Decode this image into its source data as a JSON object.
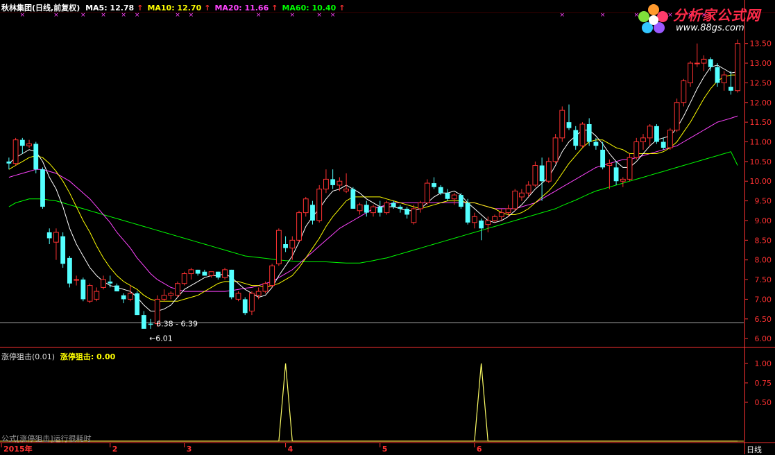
{
  "header": {
    "stock": "秋林集团(日线,前复权)",
    "ma": [
      {
        "label": "MA5: 12.78",
        "color": "#ffffff"
      },
      {
        "label": "MA10: 12.70",
        "color": "#ffff00"
      },
      {
        "label": "MA20: 11.66",
        "color": "#ff44ff"
      },
      {
        "label": "MA60: 10.40",
        "color": "#00ff00"
      }
    ],
    "arrow": "↑"
  },
  "sub_header": {
    "name": "涨停狙击(0.01)",
    "value_label": "涨停狙击: 0.00"
  },
  "logo": {
    "name": "分析家公式网",
    "url": "www.88gs.com"
  },
  "footer": {
    "formula": "公式[涨停狙击]运行很耗时",
    "period": "日线"
  },
  "colors": {
    "up": "#ff3232",
    "down": "#54ffff",
    "ma5": "#ffffff",
    "ma10": "#ffff00",
    "ma20": "#ff44ff",
    "ma60": "#00ff00",
    "grid": "#a00000",
    "axis": "#ff3232",
    "signal": "#ffff66"
  },
  "chart_data": {
    "type": "candlestick",
    "price_ticks": [
      "13.50",
      "13.00",
      "12.50",
      "12.00",
      "11.50",
      "11.00",
      "10.50",
      "10.00",
      "9.50",
      "9.00",
      "8.50",
      "8.00",
      "7.50",
      "7.00",
      "6.50",
      "6.00"
    ],
    "price_ylim": [
      5.95,
      13.6
    ],
    "reference_line": 6.4,
    "low_annotation": {
      "range_label": "6.38 - 6.39",
      "low_label": "←6.01"
    },
    "date_labels": [
      "2015年",
      "2",
      "3",
      "4",
      "5",
      "6"
    ],
    "date_label_index": [
      0,
      15,
      26,
      41,
      55,
      69
    ],
    "candles": [
      [
        10.5,
        10.6,
        10.3,
        10.45
      ],
      [
        10.45,
        11.1,
        10.4,
        11.05
      ],
      [
        11.05,
        11.1,
        10.7,
        10.9
      ],
      [
        10.9,
        11.05,
        10.85,
        10.95
      ],
      [
        10.95,
        11.0,
        10.2,
        10.3
      ],
      [
        10.3,
        10.35,
        9.3,
        9.35
      ],
      [
        8.7,
        8.8,
        8.4,
        8.55
      ],
      [
        8.45,
        8.8,
        8.0,
        8.7
      ],
      [
        8.6,
        8.7,
        7.8,
        7.9
      ],
      [
        8.05,
        8.1,
        7.3,
        7.4
      ],
      [
        7.5,
        7.6,
        7.35,
        7.5
      ],
      [
        7.5,
        7.55,
        6.95,
        7.0
      ],
      [
        6.95,
        7.4,
        6.9,
        7.35
      ],
      [
        7.0,
        7.3,
        6.95,
        7.2
      ],
      [
        7.3,
        7.6,
        7.25,
        7.5
      ],
      [
        7.45,
        7.6,
        7.3,
        7.4
      ],
      [
        7.35,
        7.4,
        7.2,
        7.2
      ],
      [
        7.1,
        7.15,
        6.9,
        7.0
      ],
      [
        7.0,
        7.35,
        6.95,
        7.15
      ],
      [
        7.15,
        7.2,
        6.6,
        6.6
      ],
      [
        6.6,
        6.7,
        6.25,
        6.25
      ],
      [
        6.38,
        6.5,
        6.25,
        6.35
      ],
      [
        6.38,
        7.1,
        6.3,
        7.0
      ],
      [
        7.0,
        7.25,
        6.95,
        7.1
      ],
      [
        7.1,
        7.2,
        7.0,
        7.15
      ],
      [
        7.1,
        7.45,
        7.05,
        7.4
      ],
      [
        7.4,
        7.7,
        7.35,
        7.65
      ],
      [
        7.65,
        7.8,
        7.5,
        7.75
      ],
      [
        7.75,
        7.75,
        7.6,
        7.65
      ],
      [
        7.7,
        7.75,
        7.6,
        7.6
      ],
      [
        7.6,
        7.7,
        7.55,
        7.7
      ],
      [
        7.7,
        7.7,
        7.5,
        7.55
      ],
      [
        7.55,
        7.8,
        7.5,
        7.75
      ],
      [
        7.75,
        7.75,
        7.0,
        7.05
      ],
      [
        7.0,
        7.2,
        6.95,
        7.15
      ],
      [
        7.0,
        7.05,
        6.6,
        6.65
      ],
      [
        6.7,
        7.2,
        6.6,
        7.15
      ],
      [
        7.1,
        7.3,
        7.0,
        7.2
      ],
      [
        7.2,
        7.45,
        7.15,
        7.4
      ],
      [
        7.35,
        7.9,
        7.3,
        7.85
      ],
      [
        7.9,
        8.8,
        7.85,
        8.75
      ],
      [
        8.4,
        8.6,
        8.2,
        8.3
      ],
      [
        8.3,
        8.6,
        8.0,
        8.5
      ],
      [
        8.5,
        9.25,
        8.45,
        9.2
      ],
      [
        9.2,
        9.6,
        9.1,
        9.55
      ],
      [
        9.4,
        9.5,
        8.9,
        9.0
      ],
      [
        9.0,
        9.9,
        8.95,
        9.8
      ],
      [
        9.8,
        10.3,
        9.7,
        10.05
      ],
      [
        10.05,
        10.3,
        9.8,
        9.9
      ],
      [
        9.9,
        10.1,
        9.75,
        10.0
      ],
      [
        9.75,
        10.2,
        9.7,
        9.8
      ],
      [
        9.8,
        9.85,
        9.3,
        9.3
      ],
      [
        9.25,
        9.45,
        9.15,
        9.4
      ],
      [
        9.4,
        9.5,
        9.1,
        9.2
      ],
      [
        9.2,
        9.4,
        9.1,
        9.35
      ],
      [
        9.35,
        9.5,
        9.1,
        9.2
      ],
      [
        9.2,
        9.5,
        9.15,
        9.45
      ],
      [
        9.45,
        9.5,
        9.3,
        9.35
      ],
      [
        9.35,
        9.4,
        9.2,
        9.3
      ],
      [
        9.3,
        9.35,
        9.05,
        9.15
      ],
      [
        8.95,
        9.4,
        8.9,
        9.3
      ],
      [
        9.3,
        9.5,
        9.2,
        9.45
      ],
      [
        9.45,
        10.05,
        9.4,
        9.95
      ],
      [
        9.95,
        10.1,
        9.8,
        9.85
      ],
      [
        9.85,
        9.9,
        9.65,
        9.7
      ],
      [
        9.7,
        9.8,
        9.5,
        9.55
      ],
      [
        9.55,
        9.7,
        9.4,
        9.65
      ],
      [
        9.65,
        9.7,
        9.3,
        9.35
      ],
      [
        9.45,
        9.55,
        8.9,
        8.95
      ],
      [
        8.95,
        9.2,
        8.8,
        9.1
      ],
      [
        9.0,
        9.05,
        8.5,
        8.8
      ],
      [
        8.9,
        9.1,
        8.7,
        9.0
      ],
      [
        9.0,
        9.15,
        8.95,
        9.1
      ],
      [
        9.1,
        9.3,
        9.0,
        9.2
      ],
      [
        9.2,
        9.4,
        9.1,
        9.3
      ],
      [
        9.3,
        9.8,
        9.25,
        9.75
      ],
      [
        9.6,
        9.8,
        9.5,
        9.7
      ],
      [
        9.7,
        10.0,
        9.6,
        9.9
      ],
      [
        9.9,
        10.5,
        9.85,
        10.4
      ],
      [
        10.4,
        10.6,
        9.5,
        10.0
      ],
      [
        10.0,
        10.6,
        9.95,
        10.5
      ],
      [
        10.5,
        11.2,
        10.45,
        11.1
      ],
      [
        11.1,
        11.9,
        11.0,
        11.8
      ],
      [
        11.5,
        11.95,
        11.3,
        11.35
      ],
      [
        11.3,
        11.4,
        10.8,
        10.9
      ],
      [
        10.9,
        11.5,
        10.85,
        11.45
      ],
      [
        11.45,
        11.6,
        10.9,
        11.0
      ],
      [
        11.0,
        11.1,
        10.8,
        10.9
      ],
      [
        10.8,
        11.0,
        10.3,
        10.35
      ],
      [
        10.4,
        10.55,
        9.8,
        10.45
      ],
      [
        10.35,
        10.5,
        9.9,
        10.0
      ],
      [
        10.0,
        10.1,
        9.85,
        10.05
      ],
      [
        10.05,
        10.7,
        10.0,
        10.6
      ],
      [
        10.6,
        11.1,
        10.55,
        11.0
      ],
      [
        11.0,
        11.2,
        10.8,
        11.1
      ],
      [
        11.1,
        11.45,
        10.9,
        11.4
      ],
      [
        11.4,
        11.45,
        10.95,
        11.0
      ],
      [
        11.0,
        11.1,
        10.8,
        10.85
      ],
      [
        10.85,
        11.35,
        10.8,
        11.3
      ],
      [
        11.3,
        12.1,
        11.25,
        12.0
      ],
      [
        12.0,
        12.6,
        11.9,
        12.55
      ],
      [
        12.5,
        13.05,
        12.4,
        13.0
      ],
      [
        13.0,
        13.5,
        12.9,
        13.0
      ],
      [
        13.0,
        13.2,
        12.8,
        13.1
      ],
      [
        13.1,
        13.15,
        12.8,
        12.9
      ],
      [
        12.9,
        13.0,
        12.4,
        12.5
      ],
      [
        12.5,
        12.8,
        12.3,
        12.7
      ],
      [
        12.4,
        12.8,
        12.2,
        12.3
      ],
      [
        12.3,
        13.6,
        12.25,
        13.5
      ]
    ],
    "ma5": [
      10.45,
      10.6,
      10.7,
      10.8,
      10.75,
      10.5,
      10.1,
      9.8,
      9.35,
      8.8,
      8.4,
      8.1,
      7.8,
      7.6,
      7.45,
      7.35,
      7.3,
      7.25,
      7.2,
      7.05,
      6.85,
      6.7,
      6.7,
      6.75,
      6.85,
      7.05,
      7.25,
      7.35,
      7.45,
      7.55,
      7.6,
      7.6,
      7.65,
      7.55,
      7.4,
      7.25,
      7.15,
      7.05,
      7.1,
      7.3,
      7.6,
      7.85,
      8.1,
      8.45,
      8.85,
      9.1,
      9.3,
      9.55,
      9.75,
      9.8,
      9.9,
      9.8,
      9.7,
      9.55,
      9.45,
      9.35,
      9.35,
      9.35,
      9.3,
      9.25,
      9.25,
      9.3,
      9.45,
      9.6,
      9.7,
      9.7,
      9.75,
      9.65,
      9.45,
      9.3,
      9.15,
      9.0,
      8.95,
      9.0,
      9.1,
      9.25,
      9.4,
      9.6,
      9.8,
      9.95,
      10.1,
      10.4,
      10.75,
      11.0,
      11.15,
      11.3,
      11.3,
      11.15,
      10.95,
      10.7,
      10.5,
      10.35,
      10.35,
      10.5,
      10.7,
      10.9,
      11.05,
      11.1,
      11.15,
      11.35,
      11.65,
      12.0,
      12.35,
      12.65,
      12.9,
      12.95,
      12.85,
      12.75,
      12.78
    ],
    "ma10": [
      10.3,
      10.4,
      10.5,
      10.6,
      10.65,
      10.6,
      10.45,
      10.25,
      10.0,
      9.7,
      9.35,
      9.0,
      8.7,
      8.35,
      8.05,
      7.8,
      7.6,
      7.45,
      7.35,
      7.25,
      7.1,
      7.0,
      6.95,
      6.95,
      6.95,
      6.95,
      7.0,
      7.05,
      7.1,
      7.2,
      7.3,
      7.4,
      7.45,
      7.45,
      7.45,
      7.4,
      7.35,
      7.35,
      7.3,
      7.35,
      7.4,
      7.5,
      7.6,
      7.8,
      8.05,
      8.3,
      8.55,
      8.85,
      9.1,
      9.3,
      9.5,
      9.6,
      9.6,
      9.6,
      9.6,
      9.6,
      9.55,
      9.5,
      9.45,
      9.4,
      9.35,
      9.3,
      9.35,
      9.4,
      9.45,
      9.5,
      9.5,
      9.5,
      9.45,
      9.45,
      9.4,
      9.35,
      9.3,
      9.2,
      9.15,
      9.15,
      9.2,
      9.3,
      9.45,
      9.6,
      9.75,
      9.95,
      10.2,
      10.45,
      10.65,
      10.85,
      11.0,
      11.05,
      11.05,
      10.95,
      10.85,
      10.8,
      10.7,
      10.7,
      10.7,
      10.7,
      10.7,
      10.75,
      10.85,
      11.0,
      11.25,
      11.5,
      11.8,
      12.1,
      12.35,
      12.55,
      12.65,
      12.7,
      12.7
    ],
    "ma20": [
      10.1,
      10.15,
      10.2,
      10.25,
      10.3,
      10.3,
      10.25,
      10.2,
      10.1,
      10.0,
      9.85,
      9.7,
      9.55,
      9.35,
      9.15,
      8.95,
      8.7,
      8.5,
      8.3,
      8.05,
      7.85,
      7.65,
      7.5,
      7.4,
      7.3,
      7.25,
      7.2,
      7.2,
      7.2,
      7.2,
      7.2,
      7.2,
      7.2,
      7.22,
      7.25,
      7.28,
      7.3,
      7.35,
      7.4,
      7.45,
      7.55,
      7.65,
      7.75,
      7.9,
      8.05,
      8.2,
      8.35,
      8.5,
      8.65,
      8.8,
      8.9,
      9.0,
      9.1,
      9.2,
      9.3,
      9.35,
      9.4,
      9.45,
      9.45,
      9.45,
      9.45,
      9.45,
      9.45,
      9.45,
      9.45,
      9.45,
      9.45,
      9.45,
      9.45,
      9.45,
      9.4,
      9.35,
      9.3,
      9.3,
      9.3,
      9.3,
      9.35,
      9.4,
      9.45,
      9.55,
      9.65,
      9.75,
      9.85,
      9.95,
      10.05,
      10.15,
      10.25,
      10.35,
      10.4,
      10.45,
      10.5,
      10.55,
      10.55,
      10.6,
      10.65,
      10.7,
      10.75,
      10.8,
      10.85,
      10.9,
      11.0,
      11.1,
      11.2,
      11.3,
      11.4,
      11.5,
      11.55,
      11.6,
      11.66
    ],
    "ma60": [
      9.35,
      9.45,
      9.5,
      9.55,
      9.55,
      9.55,
      9.52,
      9.5,
      9.45,
      9.4,
      9.35,
      9.3,
      9.25,
      9.2,
      9.15,
      9.1,
      9.05,
      9.0,
      8.95,
      8.9,
      8.85,
      8.8,
      8.75,
      8.7,
      8.65,
      8.6,
      8.55,
      8.5,
      8.45,
      8.4,
      8.35,
      8.3,
      8.25,
      8.2,
      8.15,
      8.1,
      8.08,
      8.06,
      8.04,
      8.02,
      8.0,
      7.98,
      7.97,
      7.96,
      7.95,
      7.95,
      7.95,
      7.95,
      7.94,
      7.93,
      7.92,
      7.92,
      7.92,
      7.95,
      7.98,
      8.02,
      8.05,
      8.1,
      8.15,
      8.2,
      8.25,
      8.3,
      8.35,
      8.4,
      8.45,
      8.5,
      8.55,
      8.6,
      8.65,
      8.7,
      8.75,
      8.8,
      8.85,
      8.9,
      8.95,
      9.0,
      9.05,
      9.1,
      9.15,
      9.2,
      9.25,
      9.3,
      9.38,
      9.45,
      9.52,
      9.6,
      9.68,
      9.75,
      9.8,
      9.85,
      9.9,
      9.95,
      10.0,
      10.05,
      10.1,
      10.15,
      10.2,
      10.25,
      10.3,
      10.35,
      10.4,
      10.45,
      10.5,
      10.55,
      10.6,
      10.65,
      10.7,
      10.75,
      10.4
    ],
    "indicator": {
      "name": "涨停狙击",
      "ticks": [
        "1.00",
        "0.75",
        "0.50"
      ],
      "ylim": [
        0,
        1.0
      ],
      "spike_index": [
        41,
        70
      ],
      "values_note": "0 except spike days = 1.00"
    }
  }
}
